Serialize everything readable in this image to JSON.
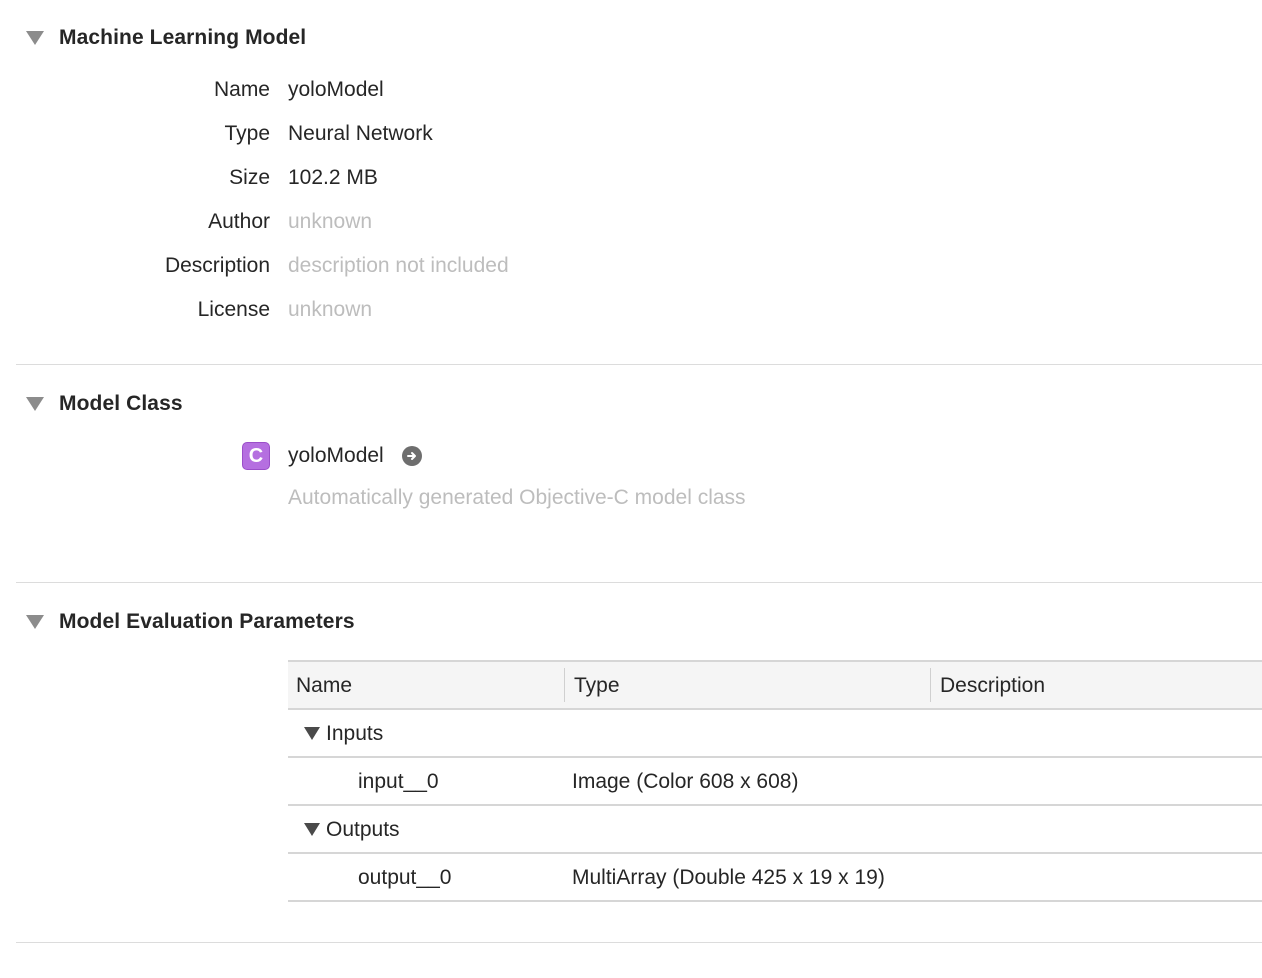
{
  "sections": {
    "ml_model": {
      "title": "Machine Learning Model"
    },
    "model_class": {
      "title": "Model Class"
    },
    "eval_params": {
      "title": "Model Evaluation Parameters"
    }
  },
  "properties": [
    {
      "label": "Name",
      "value": "yoloModel",
      "muted": false
    },
    {
      "label": "Type",
      "value": "Neural Network",
      "muted": false
    },
    {
      "label": "Size",
      "value": "102.2 MB",
      "muted": false
    },
    {
      "label": "Author",
      "value": "unknown",
      "muted": true
    },
    {
      "label": "Description",
      "value": "description not included",
      "muted": true
    },
    {
      "label": "License",
      "value": "unknown",
      "muted": true
    }
  ],
  "model_class": {
    "badge": "C",
    "name": "yoloModel",
    "description": "Automatically generated Objective-C model class",
    "badge_color": "#b56fe0",
    "icons": {
      "badge": "class-c-icon",
      "goto": "arrow-right-circle-icon"
    }
  },
  "table": {
    "columns": [
      "Name",
      "Type",
      "Description"
    ],
    "groups": {
      "inputs": {
        "label": "Inputs",
        "rows": [
          {
            "name": "input__0",
            "type": "Image (Color 608 x 608)",
            "description": ""
          }
        ]
      },
      "outputs": {
        "label": "Outputs",
        "rows": [
          {
            "name": "output__0",
            "type": "MultiArray (Double 425 x 19 x 19)",
            "description": ""
          }
        ]
      }
    }
  }
}
